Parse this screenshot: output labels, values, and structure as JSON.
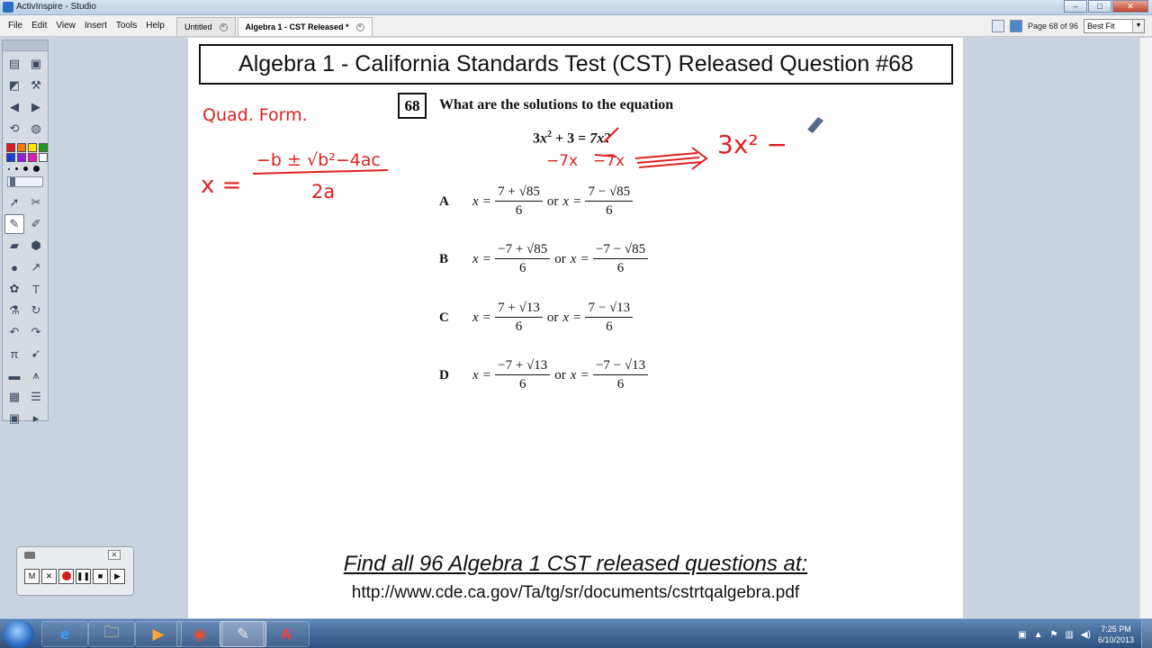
{
  "window": {
    "title": "ActivInspire - Studio",
    "controls": {
      "minimize": "–",
      "maximize": "□",
      "close": "✕"
    }
  },
  "menu": {
    "items": [
      "File",
      "Edit",
      "View",
      "Insert",
      "Tools",
      "Help"
    ]
  },
  "tabs": [
    {
      "label": "Untitled",
      "active": false
    },
    {
      "label": "Algebra 1 - CST Released *",
      "active": true
    }
  ],
  "page_control": {
    "indicator": "Page 68 of 96",
    "zoom": "Best Fit"
  },
  "palette_colors": [
    "#e01b1b",
    "#f07800",
    "#ffe600",
    "#1a9e1a",
    "#1a3ee0",
    "#9b1ae0",
    "#e01ab8",
    "#ffffff"
  ],
  "canvas": {
    "heading": "Algebra 1 - California Standards Test (CST) Released Question #68",
    "question_number": "68",
    "question": "What are the solutions to the equation",
    "equation": {
      "part1": "3",
      "var": "x",
      "exp": "2",
      "part2": " + 3 = ",
      "rhs": "7x",
      "end": "?"
    },
    "choices": [
      {
        "letter": "A",
        "x": "x",
        "eq": "=",
        "or": "or",
        "num1": "7 + √85",
        "num2": "7 − √85",
        "den": "6"
      },
      {
        "letter": "B",
        "x": "x",
        "eq": "=",
        "or": "or",
        "num1": "−7 + √85",
        "num2": "−7 − √85",
        "den": "6"
      },
      {
        "letter": "C",
        "x": "x",
        "eq": "=",
        "or": "or",
        "num1": "7 + √13",
        "num2": "7 − √13",
        "den": "6"
      },
      {
        "letter": "D",
        "x": "x",
        "eq": "=",
        "or": "or",
        "num1": "−7 + √13",
        "num2": "−7 − √13",
        "den": "6"
      }
    ],
    "footer_title": "Find all 96 Algebra 1 CST released questions at:",
    "footer_url": "http://www.cde.ca.gov/Ta/tg/sr/documents/cstrtqalgebra.pdf",
    "annotations": {
      "quad_form": "Quad. Form.",
      "formula_x": "x =",
      "formula_num": "−b ± √b²−4ac",
      "formula_den": "2a",
      "minus_7x_left": "−7x",
      "minus_7x_right": "−7x",
      "result": "3x² −",
      "color": "#e02020"
    }
  },
  "recorder": {
    "buttons": [
      "M",
      "✕",
      "●",
      "❚❚",
      "■",
      "▶"
    ]
  },
  "taskbar": {
    "apps": [
      {
        "name": "internet-explorer",
        "glyph": "e"
      },
      {
        "name": "file-explorer",
        "glyph": "🗀"
      },
      {
        "name": "media-player",
        "glyph": "▶"
      },
      {
        "name": "chrome",
        "glyph": "◉"
      },
      {
        "name": "activinspire",
        "glyph": "✎"
      },
      {
        "name": "adobe-reader",
        "glyph": "A"
      }
    ],
    "clock_time": "7:25 PM",
    "clock_date": "6/10/2013"
  }
}
